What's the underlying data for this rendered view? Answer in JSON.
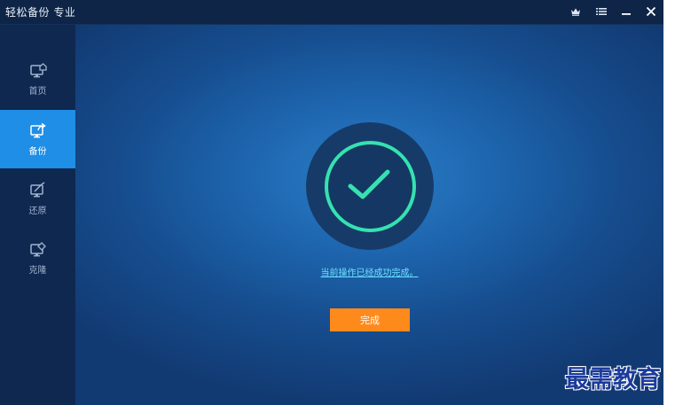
{
  "app": {
    "title": "轻松备份 专业"
  },
  "titlebar": {
    "controls": [
      {
        "name": "crown-icon"
      },
      {
        "name": "menu-icon"
      },
      {
        "name": "minimize-icon"
      },
      {
        "name": "close-icon"
      }
    ]
  },
  "sidebar": {
    "items": [
      {
        "label": "首页",
        "icon": "home-monitor-icon",
        "active": false
      },
      {
        "label": "备份",
        "icon": "backup-monitor-icon",
        "active": true
      },
      {
        "label": "还原",
        "icon": "restore-monitor-icon",
        "active": false
      },
      {
        "label": "克隆",
        "icon": "clone-monitor-icon",
        "active": false
      }
    ]
  },
  "main": {
    "status_message": "当前操作已经成功完成。",
    "finish_button": "完成"
  },
  "colors": {
    "accent_blue": "#1f8ee6",
    "success_ring": "#35e2b0",
    "button_orange": "#ff8a1c",
    "link_color": "#6ee0ff"
  },
  "watermark": "最需教育"
}
